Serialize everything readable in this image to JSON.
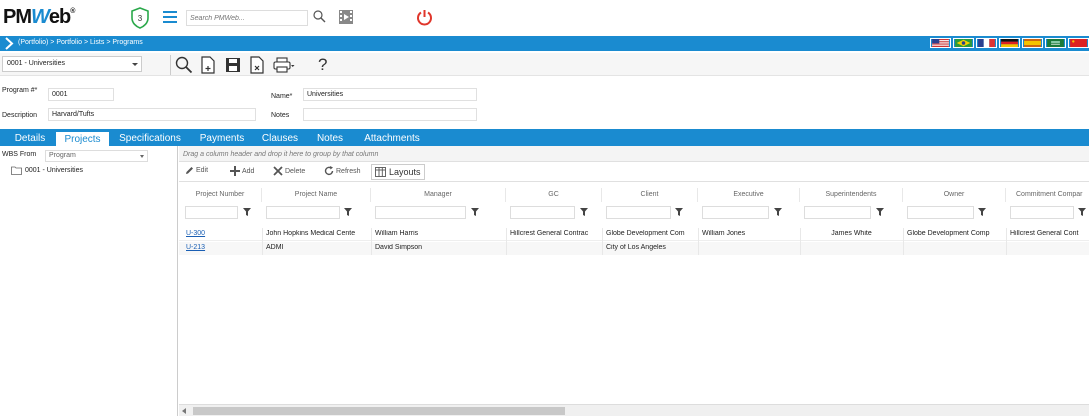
{
  "header": {
    "logo_main": "PM",
    "logo_w": "W",
    "logo_rest": "eb",
    "logo_reg": "®",
    "badge_count": "3",
    "search_placeholder": "Search PMWeb..."
  },
  "breadcrumb": "(Portfolio) > Portfolio > Lists > Programs",
  "toolbar": {
    "selected_program": "0001 - Universities",
    "help_label": "?"
  },
  "form": {
    "program_label": "Program #*",
    "program_value": "0001",
    "name_label": "Name*",
    "name_value": "Universities",
    "description_label": "Description",
    "description_value": "Harvard/Tufts",
    "notes_label": "Notes",
    "notes_value": ""
  },
  "tabs": [
    {
      "label": "Details"
    },
    {
      "label": "Projects"
    },
    {
      "label": "Specifications"
    },
    {
      "label": "Payments"
    },
    {
      "label": "Clauses"
    },
    {
      "label": "Notes"
    },
    {
      "label": "Attachments"
    }
  ],
  "left_panel": {
    "wbs_label": "WBS From",
    "wbs_value": "Program",
    "tree_item": "0001 - Universities"
  },
  "grid": {
    "group_hint": "Drag a column header and drop it here to group by that column",
    "tools": {
      "edit": "Edit",
      "add": "Add",
      "delete": "Delete",
      "refresh": "Refresh",
      "layouts": "Layouts"
    },
    "columns": [
      "Project Number",
      "Project Name",
      "Manager",
      "GC",
      "Client",
      "Executive",
      "Superintendents",
      "Owner",
      "Commitment Compar"
    ],
    "rows": [
      [
        "U-300",
        "John Hopkins Medical Cente",
        "William Harris",
        "Hillcrest General Contrac",
        "Globe Development Com",
        "William Jones",
        "James White",
        "Globe Development Comp",
        "Hillcrest General Cont"
      ],
      [
        "U-213",
        "ADMI",
        "David Simpson",
        "",
        "City of Los Angeles",
        "",
        "",
        "",
        ""
      ]
    ]
  },
  "colors": {
    "accent": "#1a8bd0",
    "power": "#e0362b"
  }
}
